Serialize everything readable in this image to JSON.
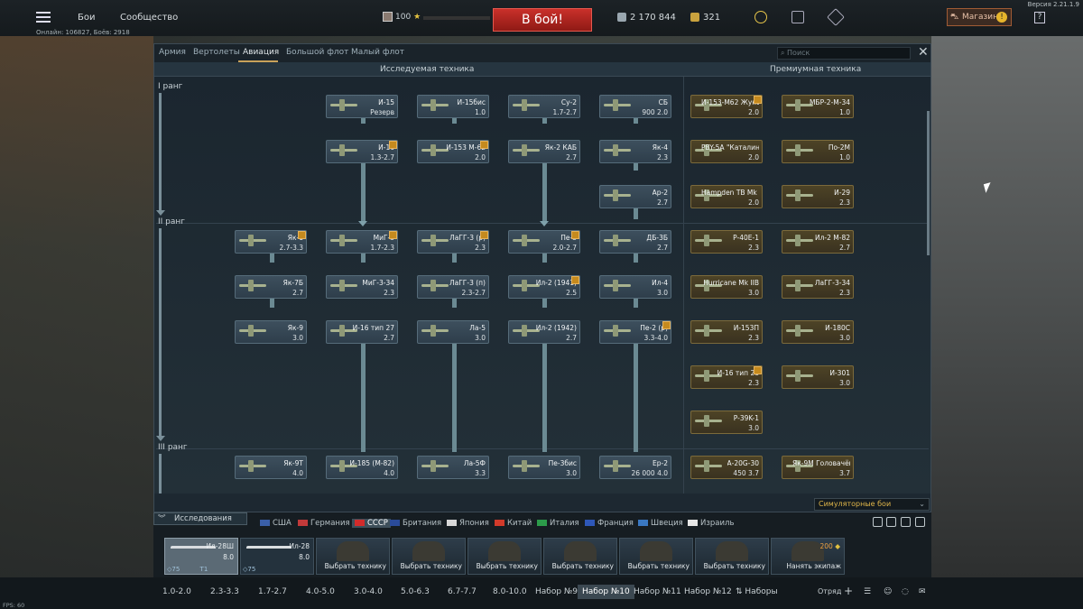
{
  "topbar": {
    "nav": [
      "Бои",
      "Сообщество"
    ],
    "online": "Онлайн: 106827, Боёв: 2918",
    "rank_level": "100",
    "battle": "В бой!",
    "silver": "2 170 844",
    "gold": "321",
    "shop": "Магазин",
    "help": "?",
    "version": "Версия 2.21.1.9"
  },
  "tabs": {
    "items": [
      "Армия",
      "Вертолеты",
      "Авиация",
      "Большой флот",
      "Малый флот"
    ],
    "active": "Авиация",
    "search_placeholder": "Поиск"
  },
  "sections": {
    "researchable": "Исследуемая техника",
    "premium": "Премиумная техника"
  },
  "ranks": [
    "I ранг",
    "II ранг",
    "III ранг"
  ],
  "vehicles": [
    {
      "name": "И-15",
      "br": "Резерв",
      "prem": false
    },
    {
      "name": "И-16",
      "br": "1.3-2.7",
      "prem": false
    },
    {
      "name": "И-15бис",
      "br": "1.0",
      "prem": false
    },
    {
      "name": "И-153 М-62",
      "br": "2.0",
      "prem": false
    },
    {
      "name": "Су-2",
      "br": "1.7-2.7",
      "prem": false
    },
    {
      "name": "Як-2 КАБ",
      "br": "2.7",
      "prem": false
    },
    {
      "name": "СБ",
      "br": "900 2.0",
      "prem": false
    },
    {
      "name": "Як-4",
      "br": "2.3",
      "prem": false
    },
    {
      "name": "Ар-2",
      "br": "2.7",
      "prem": false
    },
    {
      "name": "Як-1",
      "br": "2.7-3.3",
      "prem": false
    },
    {
      "name": "МиГ-3",
      "br": "1.7-2.3",
      "prem": false
    },
    {
      "name": "ЛаГГ-3 (р)",
      "br": "2.3",
      "prem": false
    },
    {
      "name": "Пе-3",
      "br": "2.0-2.7",
      "prem": false
    },
    {
      "name": "ДБ-3Б",
      "br": "2.7",
      "prem": false
    },
    {
      "name": "Як-7Б",
      "br": "2.7",
      "prem": false
    },
    {
      "name": "МиГ-3-34",
      "br": "2.3",
      "prem": false
    },
    {
      "name": "ЛаГГ-3 (п)",
      "br": "2.3-2.7",
      "prem": false
    },
    {
      "name": "Ил-2 (1941)",
      "br": "2.5",
      "prem": false
    },
    {
      "name": "Ил-4",
      "br": "3.0",
      "prem": false
    },
    {
      "name": "Як-9",
      "br": "3.0",
      "prem": false
    },
    {
      "name": "И-16 тип 27",
      "br": "2.7",
      "prem": false
    },
    {
      "name": "Ла-5",
      "br": "3.0",
      "prem": false
    },
    {
      "name": "Ил-2 (1942)",
      "br": "2.7",
      "prem": false
    },
    {
      "name": "Пе-2 (р)",
      "br": "3.3-4.0",
      "prem": false
    },
    {
      "name": "Як-9Т",
      "br": "4.0",
      "prem": false
    },
    {
      "name": "И-185 (М-82)",
      "br": "4.0",
      "prem": false
    },
    {
      "name": "Ла-5Ф",
      "br": "3.3",
      "prem": false
    },
    {
      "name": "Пе-3бис",
      "br": "3.0",
      "prem": false
    },
    {
      "name": "Ер-2",
      "br": "26 000 4.0",
      "prem": false
    },
    {
      "name": "И-153-М62 Жуковского",
      "br": "2.0",
      "prem": true
    },
    {
      "name": "МБР-2-М-34",
      "br": "1.0",
      "prem": true
    },
    {
      "name": "PBY-5A \"Каталина\"",
      "br": "2.0",
      "prem": true
    },
    {
      "name": "По-2М",
      "br": "1.0",
      "prem": true
    },
    {
      "name": "Hampden TB Mk I",
      "br": "2.0",
      "prem": true
    },
    {
      "name": "И-29",
      "br": "2.3",
      "prem": true
    },
    {
      "name": "P-40E-1",
      "br": "2.3",
      "prem": true
    },
    {
      "name": "Ил-2 М-82",
      "br": "2.7",
      "prem": true
    },
    {
      "name": "Hurricane Mk IIB",
      "br": "3.0",
      "prem": true
    },
    {
      "name": "ЛаГГ-3-34",
      "br": "2.3",
      "prem": true
    },
    {
      "name": "И-153П",
      "br": "2.3",
      "prem": true
    },
    {
      "name": "И-180С",
      "br": "3.0",
      "prem": true
    },
    {
      "name": "И-16 тип 28",
      "br": "2.3",
      "prem": true
    },
    {
      "name": "И-301",
      "br": "3.0",
      "prem": true
    },
    {
      "name": "P-39K-1",
      "br": "3.0",
      "prem": true
    },
    {
      "name": "А-20G-30",
      "br": "450 3.7",
      "prem": true
    },
    {
      "name": "Як-9М Головачёва",
      "br": "3.7",
      "prem": true
    }
  ],
  "mode": "Симуляторные бои",
  "research_button": "Исследования",
  "nations": [
    "США",
    "Германия",
    "СССР",
    "Британия",
    "Япония",
    "Китай",
    "Италия",
    "Франция",
    "Швеция",
    "Израиль"
  ],
  "nation_colors": [
    "#3a5fa8",
    "#c23a3a",
    "#d22b2b",
    "#2a4b9a",
    "#d8d8d8",
    "#d23a2a",
    "#2c9b4a",
    "#2e57b8",
    "#3a78c2",
    "#e6e6e6"
  ],
  "active_nation": "СССР",
  "slots": [
    {
      "name": "Ил-28Ш",
      "br": "8.0",
      "sp": "75",
      "extra": "Т1"
    },
    {
      "name": "Ил-28",
      "br": "8.0",
      "sp": "75",
      "extra": ""
    },
    {
      "name": "Выбрать технику"
    },
    {
      "name": "Выбрать технику"
    },
    {
      "name": "Выбрать технику"
    },
    {
      "name": "Выбрать технику"
    },
    {
      "name": "Выбрать технику"
    },
    {
      "name": "Выбрать технику"
    },
    {
      "name": "Нанять экипаж",
      "cost": "200"
    }
  ],
  "presets": [
    "1.0-2.0",
    "2.3-3.3",
    "1.7-2.7",
    "4.0-5.0",
    "3.0-4.0",
    "5.0-6.3",
    "6.7-7.7",
    "8.0-10.0",
    "Набор №9",
    "Набор №10",
    "Набор №11",
    "Набор №12",
    "Наборы"
  ],
  "active_preset": "Набор №10",
  "squad_label": "Отряд",
  "fps": "FPS: 60"
}
